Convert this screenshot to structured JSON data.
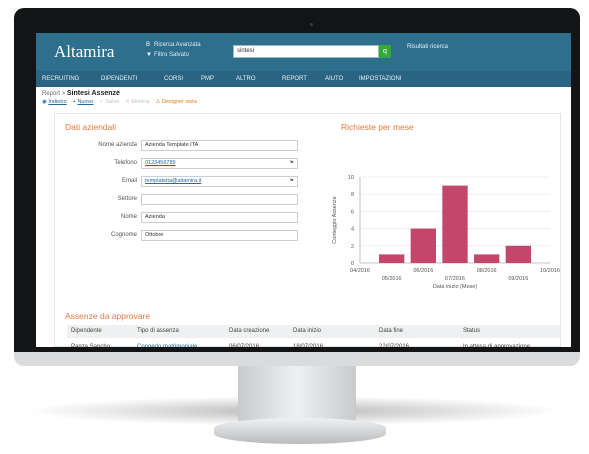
{
  "header": {
    "logo": "Altamira",
    "advanced_search": "Ricerca Avanzata",
    "saved_filter": "Filtro Salvato",
    "search_value": "sintesi",
    "results_label": "Risultati ricerca"
  },
  "nav": [
    "RECRUITING",
    "DIPENDENTI",
    "CORSI",
    "PMP",
    "ALTRO",
    "REPORT",
    "AIUTO",
    "IMPOSTAZIONI"
  ],
  "breadcrumb": {
    "parent": "Report",
    "sep": " > ",
    "current": "Sintesi Assenze"
  },
  "actions": [
    {
      "label": "Indietro",
      "style": "link"
    },
    {
      "label": "Nuovo",
      "style": "link"
    },
    {
      "label": "Salva",
      "style": "dim"
    },
    {
      "label": "Elimina",
      "style": "dim"
    },
    {
      "label": "Designer vista",
      "style": "warn"
    }
  ],
  "company": {
    "title": "Dati aziendali",
    "fields": [
      {
        "label": "Nome azienda",
        "value": "Azienda Template ITA",
        "link": false,
        "pin": false
      },
      {
        "label": "Telefono",
        "value": "0123456789",
        "link": true,
        "pin": true
      },
      {
        "label": "Email",
        "value": "templateita@altamira.it",
        "link": true,
        "pin": true
      },
      {
        "label": "Settore",
        "value": "",
        "link": false,
        "pin": false
      },
      {
        "label": "Nome",
        "value": "Azienda",
        "link": false,
        "pin": false
      },
      {
        "label": "Cognome",
        "value": "Ottobre",
        "link": false,
        "pin": false
      }
    ]
  },
  "chart_title": "Richieste per mese",
  "chart_data": {
    "type": "bar",
    "categories": [
      "04/2016",
      "05/2016",
      "06/2016",
      "07/2016",
      "08/2016",
      "09/2016",
      "10/2016"
    ],
    "x_ticks": [
      "04/2016",
      "05/2016",
      "06/2016",
      "07/2016",
      "08/2016",
      "09/2016",
      "10/2016"
    ],
    "values": [
      0,
      1,
      4,
      9,
      1,
      2,
      0
    ],
    "ylabel": "Conteggio Assenze",
    "xlabel": "Data inizio (Mese)",
    "ylim": [
      0,
      10
    ],
    "y_ticks": [
      0,
      2,
      4,
      6,
      8,
      10
    ],
    "bar_color": "#c4476b",
    "grid": true
  },
  "approvals": {
    "title": "Assenze da approvare",
    "columns": [
      "Dipendente",
      "Tipo di assenza",
      "Data creazione",
      "Data inizio",
      "Data fine",
      "Status"
    ],
    "rows": [
      [
        "Panza Sancho",
        "Congedo matrimoniale",
        "06/07/2016",
        "18/07/2016",
        "22/07/2016",
        "In attesa di approvazione"
      ]
    ]
  },
  "colors": {
    "header": "#2f6f8e",
    "nav": "#2a6482",
    "accent": "#e9793a",
    "search_button": "#35a83a"
  }
}
